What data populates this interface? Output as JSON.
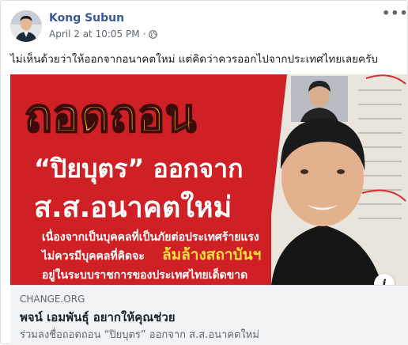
{
  "post": {
    "author": "Kong Subun",
    "timestamp": "April 2 at 10:05 PM",
    "separator": "·",
    "privacy_icon": "globe-icon",
    "more_icon": "more-options-icon",
    "text": "ไม่เห็นด้วยว่าให้ออกจากอนาคตใหม่ แต่คิดว่าควรออกไปจากประเทศไทยเลยครับ"
  },
  "image": {
    "headline1": "ถอดถอน",
    "headline2": "“ปิยบุตร” ออกจาก",
    "headline3": "ส.ส.อนาคตใหม่",
    "body1": "เนื่องจากเป็นบุคคลที่เป็นภัยต่อประเทศร้ายแรง",
    "body2a": "ไม่ควรมีบุคคลที่คิดจะ",
    "body2b": "ล้มล้างสถาบันฯ",
    "body3": "อยู่ในระบบราชการของประเทศไทยเด็ดขาด",
    "colors": {
      "background": "#cf2026",
      "headline": "#f5c400",
      "highlight": "#ffe135",
      "text": "#ffffff"
    }
  },
  "link": {
    "domain": "CHANGE.ORG",
    "title": "พจน์ เอมพันธุ์ อยากให้คุณช่วย",
    "description": "ร่วมลงชื่อถอดถอน “ปิยบุตร” ออกจาก ส.ส.อนาคตใหม่",
    "info_icon": "info-icon"
  }
}
